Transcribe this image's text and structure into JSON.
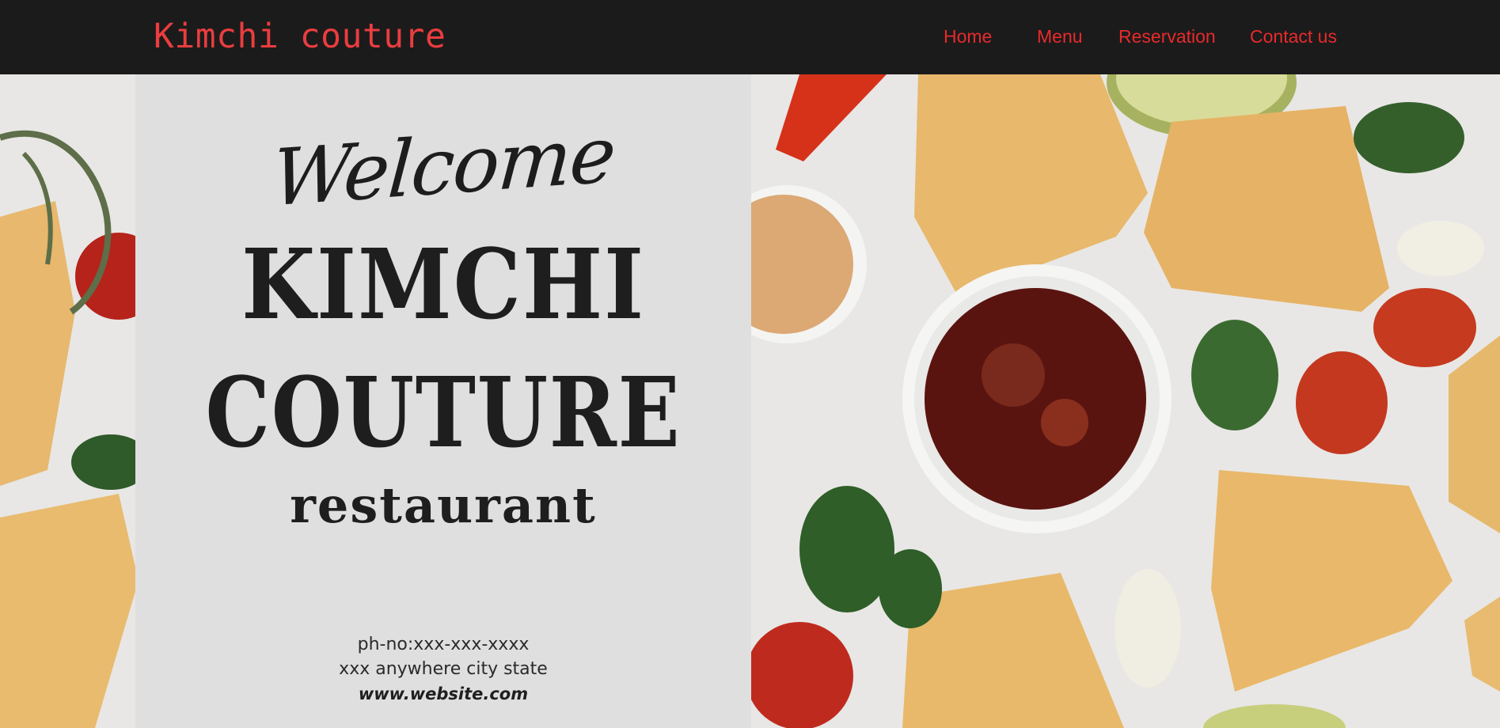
{
  "nav": {
    "brand": "Kimchi couture",
    "links": [
      "Home",
      "Menu",
      "Reservation",
      "Contact us"
    ]
  },
  "poster": {
    "welcome": "Welcome",
    "title_line1": "KIMCHI",
    "title_line2": "COUTURE",
    "title_line3": "restaurant",
    "phone": "ph-no:xxx-xxx-xxxx",
    "address": "xxx anywhere city state",
    "website": "www.website.com"
  },
  "colors": {
    "nav_bg": "#1b1b1b",
    "accent": "#ea3d3f",
    "card_bg": "#dfdfdf",
    "text_dark": "#1e1e1e"
  },
  "hero_image": "food-table-photo"
}
